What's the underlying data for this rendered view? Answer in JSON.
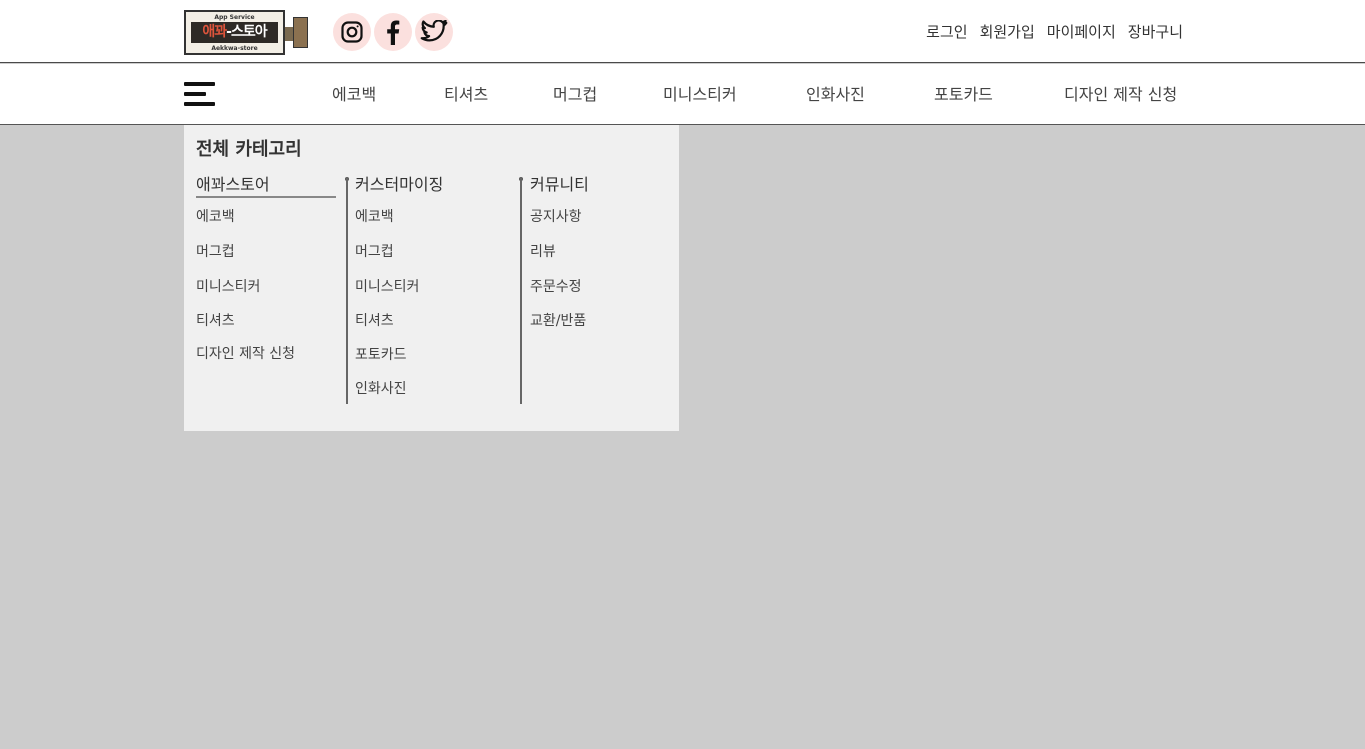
{
  "logo": {
    "top": "App Service",
    "main_a": "애꽈",
    "main_b": "-스토아",
    "bottom": "Aekkwa-store"
  },
  "social": [
    {
      "icon": "instagram-icon"
    },
    {
      "icon": "facebook-icon"
    },
    {
      "icon": "twitter-icon"
    }
  ],
  "top_links": [
    "로그인",
    "회원가입",
    "마이페이지",
    "장바구니"
  ],
  "nav": [
    "에코백",
    "티셔츠",
    "머그컵",
    "미니스티커",
    "인화사진",
    "포토카드",
    "디자인 제작 신청"
  ],
  "dropdown": {
    "title": "전체 카테고리",
    "columns": [
      {
        "header": "애꽈스토어",
        "items": [
          "에코백",
          "머그컵",
          "미니스티커",
          "티셔츠",
          "디자인 제작 신청"
        ]
      },
      {
        "header": "커스터마이징",
        "items": [
          "에코백",
          "머그컵",
          "미니스티커",
          "티셔츠",
          "포토카드",
          "인화사진"
        ]
      },
      {
        "header": "커뮤니티",
        "items": [
          "공지사항",
          "리뷰",
          "주문수정",
          "교환/반품"
        ]
      }
    ]
  },
  "colors": {
    "overlay": "#cccccc",
    "panel": "#f0f0f0",
    "social_bg": "#fbe0de",
    "logo_accent": "#e0553c"
  }
}
